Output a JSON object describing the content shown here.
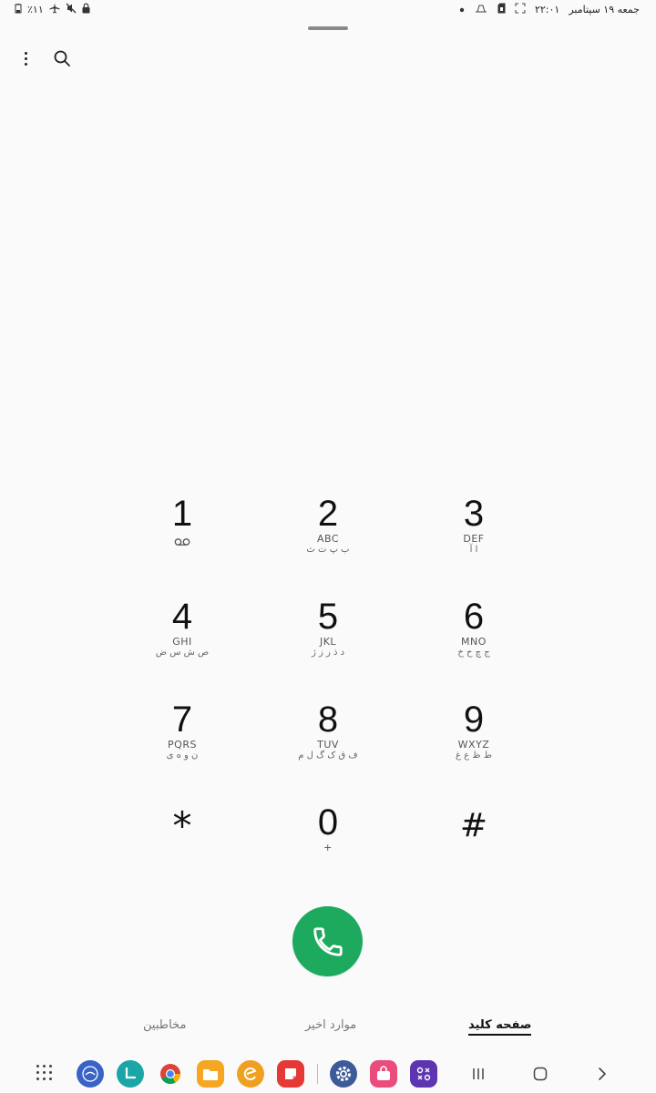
{
  "status_bar": {
    "battery_text": "٪۱۱",
    "date_text": "جمعه ۱۹ سپتامبر",
    "time_text": "۲۲:۰۱",
    "icons": [
      "battery-icon",
      "airplane-icon",
      "mute-icon",
      "lock-icon",
      "dot-icon",
      "sim-icon",
      "notify-icon",
      "screenshot-icon"
    ]
  },
  "keypad": {
    "keys": [
      {
        "digit": "1",
        "latin": "",
        "persian": ""
      },
      {
        "digit": "2",
        "latin": "ABC",
        "persian": "ب پ ت ث"
      },
      {
        "digit": "3",
        "latin": "DEF",
        "persian": "ا آ"
      },
      {
        "digit": "4",
        "latin": "GHI",
        "persian": "ص ش س ض"
      },
      {
        "digit": "5",
        "latin": "JKL",
        "persian": "د ذ ر ز ژ"
      },
      {
        "digit": "6",
        "latin": "MNO",
        "persian": "ج چ ح خ"
      },
      {
        "digit": "7",
        "latin": "PQRS",
        "persian": "ن و ه ی"
      },
      {
        "digit": "8",
        "latin": "TUV",
        "persian": "ف ق ک گ ل م"
      },
      {
        "digit": "9",
        "latin": "WXYZ",
        "persian": "ط ظ ع غ"
      },
      {
        "digit": "*",
        "latin": "",
        "persian": ""
      },
      {
        "digit": "0",
        "latin": "+",
        "persian": ""
      },
      {
        "digit": "#",
        "latin": "",
        "persian": ""
      }
    ]
  },
  "tabs": {
    "keypad": "صفحه کلید",
    "recents": "موارد اخیر",
    "contacts": "مخاطبین"
  },
  "colors": {
    "call_green": "#1eaa5e",
    "background": "#fafafa"
  }
}
